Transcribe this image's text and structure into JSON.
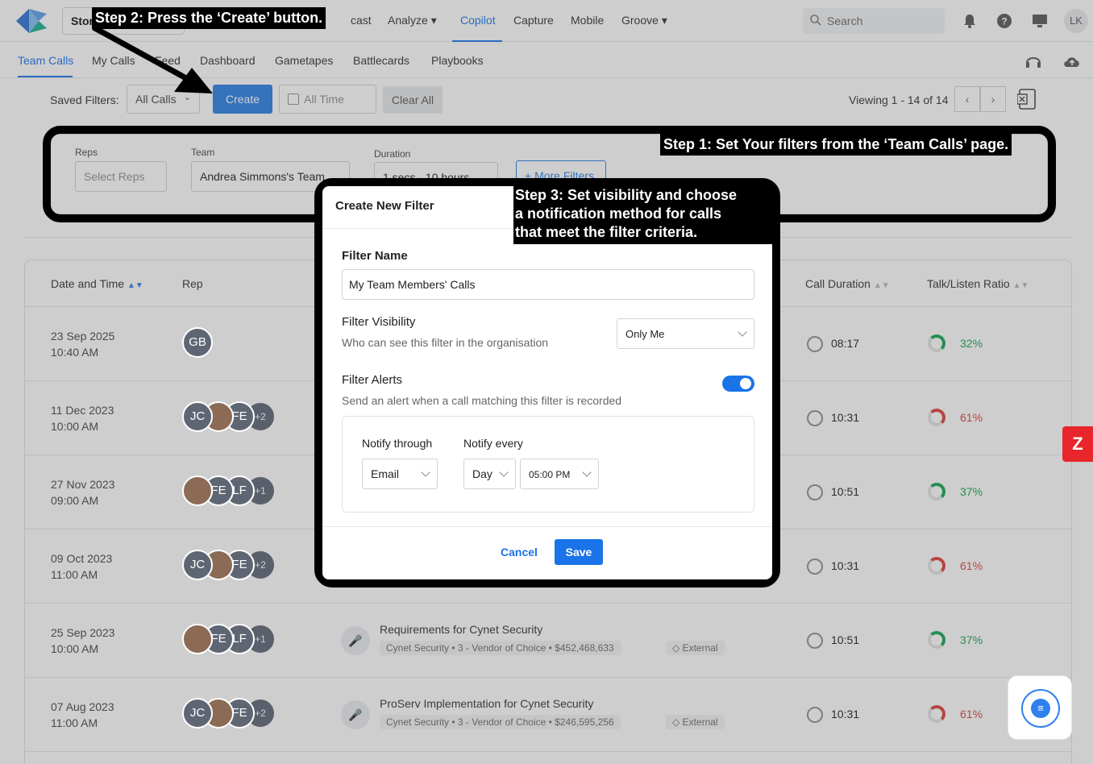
{
  "nav": {
    "store_label": "Stor",
    "items": [
      "cast",
      "Analyze",
      "Copilot",
      "Capture",
      "Mobile",
      "Groove"
    ],
    "search_placeholder": "Search",
    "avatar_initials": "LK"
  },
  "subnav": {
    "items": [
      "Team Calls",
      "My Calls",
      "Feed",
      "Dashboard",
      "Gametapes",
      "Battlecards",
      "Playbooks"
    ]
  },
  "toolbar": {
    "saved_filters_label": "Saved Filters:",
    "saved_filter_value": "All Calls",
    "create_label": "Create",
    "time_label": "All Time",
    "clear_label": "Clear All",
    "viewing": "Viewing 1 - 14 of 14"
  },
  "filters": {
    "reps_label": "Reps",
    "reps_placeholder": "Select Reps",
    "team_label": "Team",
    "team_value": "Andrea Simmons's Team",
    "duration_label": "Duration",
    "duration_value": "1 secs - 10 hours",
    "more_filters": "+ More Filters"
  },
  "table": {
    "headers": {
      "date": "Date and Time",
      "rep": "Rep",
      "duration": "Call Duration",
      "ratio": "Talk/Listen Ratio"
    },
    "rows": [
      {
        "date": "23 Sep 2025",
        "time": "10:40 AM",
        "reps": [
          "GB"
        ],
        "more": "",
        "title": "",
        "account": "",
        "stage": "",
        "amount": "",
        "tag": "",
        "duration": "08:17",
        "ratio": "32%",
        "ratio_status": "good"
      },
      {
        "date": "11 Dec 2023",
        "time": "10:00 AM",
        "reps": [
          "JC",
          "",
          "FE"
        ],
        "more": "+2",
        "title": "",
        "account": "",
        "stage": "",
        "amount": "",
        "tag": "",
        "duration": "10:31",
        "ratio": "61%",
        "ratio_status": "bad"
      },
      {
        "date": "27 Nov 2023",
        "time": "09:00 AM",
        "reps": [
          "",
          "FE",
          "LF"
        ],
        "more": "+1",
        "title": "",
        "account": "",
        "stage": "",
        "amount": "",
        "tag": "",
        "duration": "10:51",
        "ratio": "37%",
        "ratio_status": "good"
      },
      {
        "date": "09 Oct 2023",
        "time": "11:00 AM",
        "reps": [
          "JC",
          "",
          "FE"
        ],
        "more": "+2",
        "title": "",
        "account": "",
        "stage": "",
        "amount": "",
        "tag": "",
        "duration": "10:31",
        "ratio": "61%",
        "ratio_status": "bad"
      },
      {
        "date": "25 Sep 2023",
        "time": "10:00 AM",
        "reps": [
          "",
          "FE",
          "LF"
        ],
        "more": "+1",
        "title": "Requirements for Cynet Security",
        "account": "Cynet Security",
        "stage": "3 - Vendor of Choice",
        "amount": "$452,468,633",
        "tag": "External",
        "duration": "10:51",
        "ratio": "37%",
        "ratio_status": "good"
      },
      {
        "date": "07 Aug 2023",
        "time": "11:00 AM",
        "reps": [
          "JC",
          "",
          "FE"
        ],
        "more": "+2",
        "title": "ProServ Implementation for Cynet Security",
        "account": "Cynet Security",
        "stage": "3 - Vendor of Choice",
        "amount": "$246,595,256",
        "tag": "External",
        "duration": "10:31",
        "ratio": "61%",
        "ratio_status": "bad"
      }
    ]
  },
  "modal": {
    "title": "Create New Filter",
    "name_label": "Filter Name",
    "name_value": "My Team Members' Calls",
    "visibility_label": "Filter Visibility",
    "visibility_sub": "Who can see this filter in the organisation",
    "visibility_value": "Only Me",
    "alerts_label": "Filter Alerts",
    "alerts_sub": "Send an alert when a call matching this filter is recorded",
    "alerts_enabled": true,
    "notify_through_label": "Notify through",
    "notify_through_value": "Email",
    "notify_every_label": "Notify every",
    "notify_every_value": "Day",
    "notify_time_value": "05:00 PM",
    "cancel_label": "Cancel",
    "save_label": "Save"
  },
  "annotations": {
    "step1": "Step 1: Set Your filters from the ‘Team Calls’ page.",
    "step2": "Step 2: Press the ‘Create’ button.",
    "step3_line1": "Step 3: Set visibility and choose",
    "step3_line2": "a notification method for calls",
    "step3_line3": "that meet the filter criteria."
  },
  "colors": {
    "accent": "#2f80ed",
    "good": "#27ae60",
    "bad": "#e0514e",
    "badge": "#e8262b"
  }
}
